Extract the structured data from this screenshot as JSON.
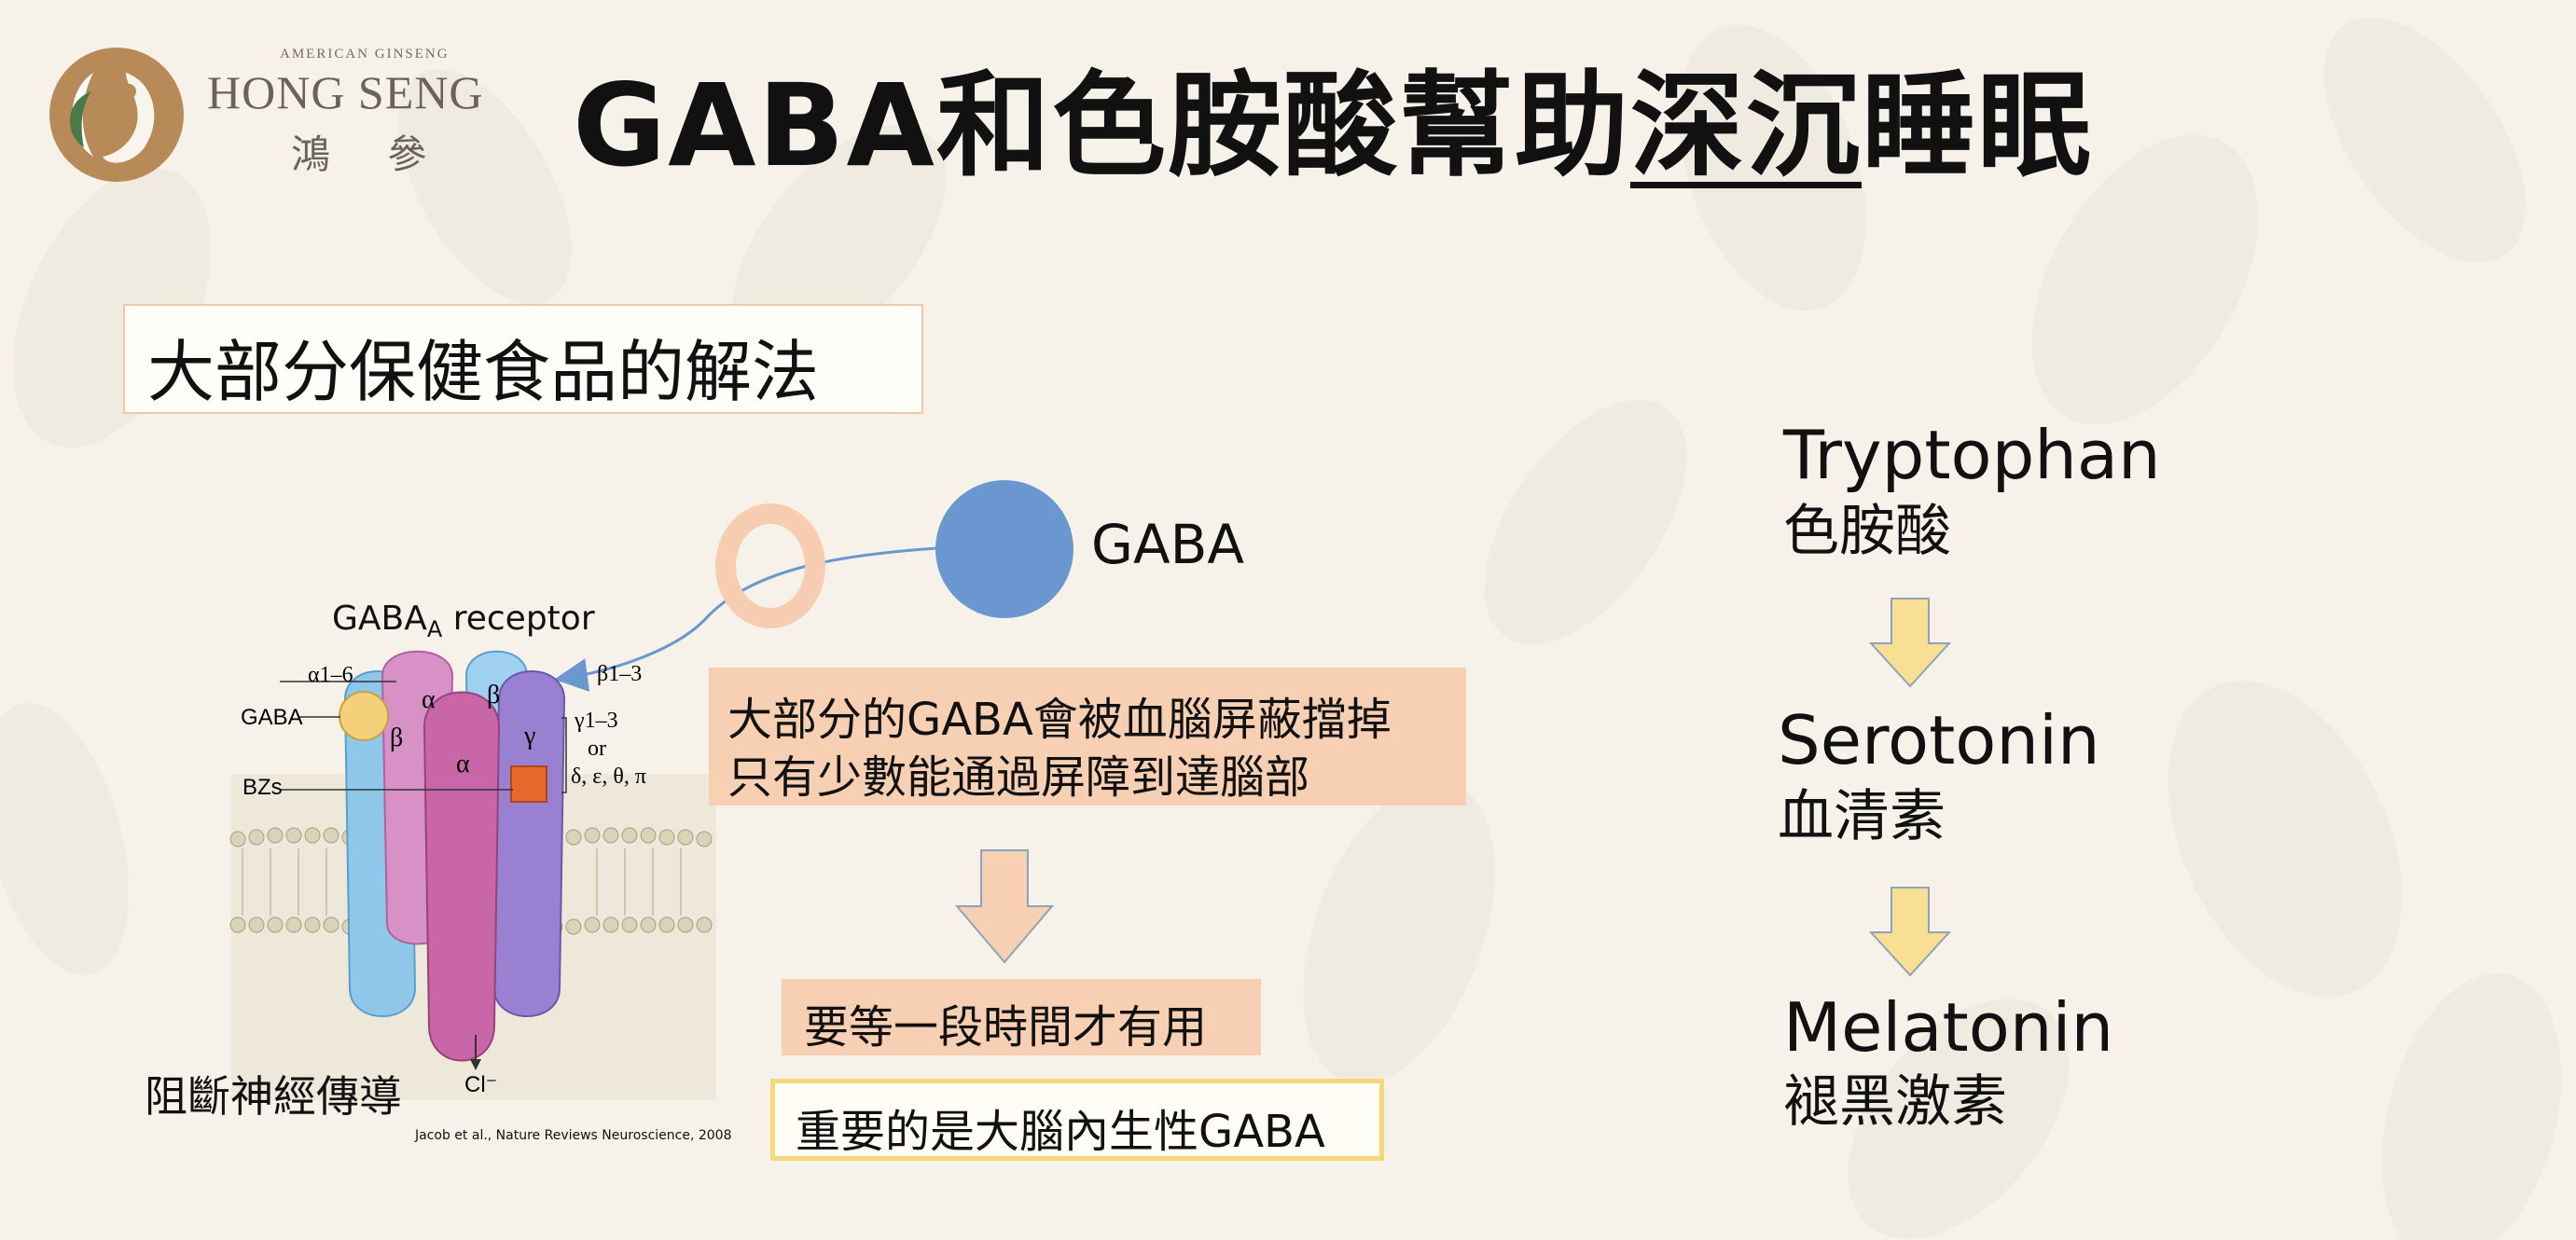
{
  "logo": {
    "small": "AMERICAN GINSENG",
    "brand": "HONG SENG",
    "chinese": "鴻 參"
  },
  "title": {
    "part1": "GABA和色胺酸幫助",
    "underlined": "深沉",
    "part2": "睡眠"
  },
  "section_label": "大部分保健食品的解法",
  "gaba_molecule_label": "GABA",
  "receptor_figure": {
    "title_prefix": "GABA",
    "title_sub": "A",
    "title_suffix": " receptor",
    "labels": {
      "alpha_range": "α1–6",
      "gaba": "GABA",
      "bzs": "BZs",
      "beta_range": "β1–3",
      "gamma_range": "γ1–3",
      "or": "or",
      "others": "δ, ε, θ, π",
      "alpha": "α",
      "beta": "β",
      "gamma": "γ",
      "chloride": "Cl⁻"
    },
    "caption": "阻斷神經傳導",
    "citation": "Jacob et al., Nature Reviews Neuroscience, 2008"
  },
  "info_block": {
    "line1": "大部分的GABA會被血腦屏蔽擋掉",
    "line2": "只有少數能通過屏障到達腦部"
  },
  "wait_block": "要等一段時間才有用",
  "key_block": "重要的是大腦內生性GABA",
  "pathway": [
    {
      "en": "Tryptophan",
      "cn": "色胺酸"
    },
    {
      "en": "Serotonin",
      "cn": "血清素"
    },
    {
      "en": "Melatonin",
      "cn": "褪黑激素"
    }
  ],
  "colors": {
    "peach": "#f7cfb2",
    "gaba_blue": "#6a97cf",
    "arrow_yellow": "#f8df94",
    "highlight_yellow": "#f5d77c"
  }
}
